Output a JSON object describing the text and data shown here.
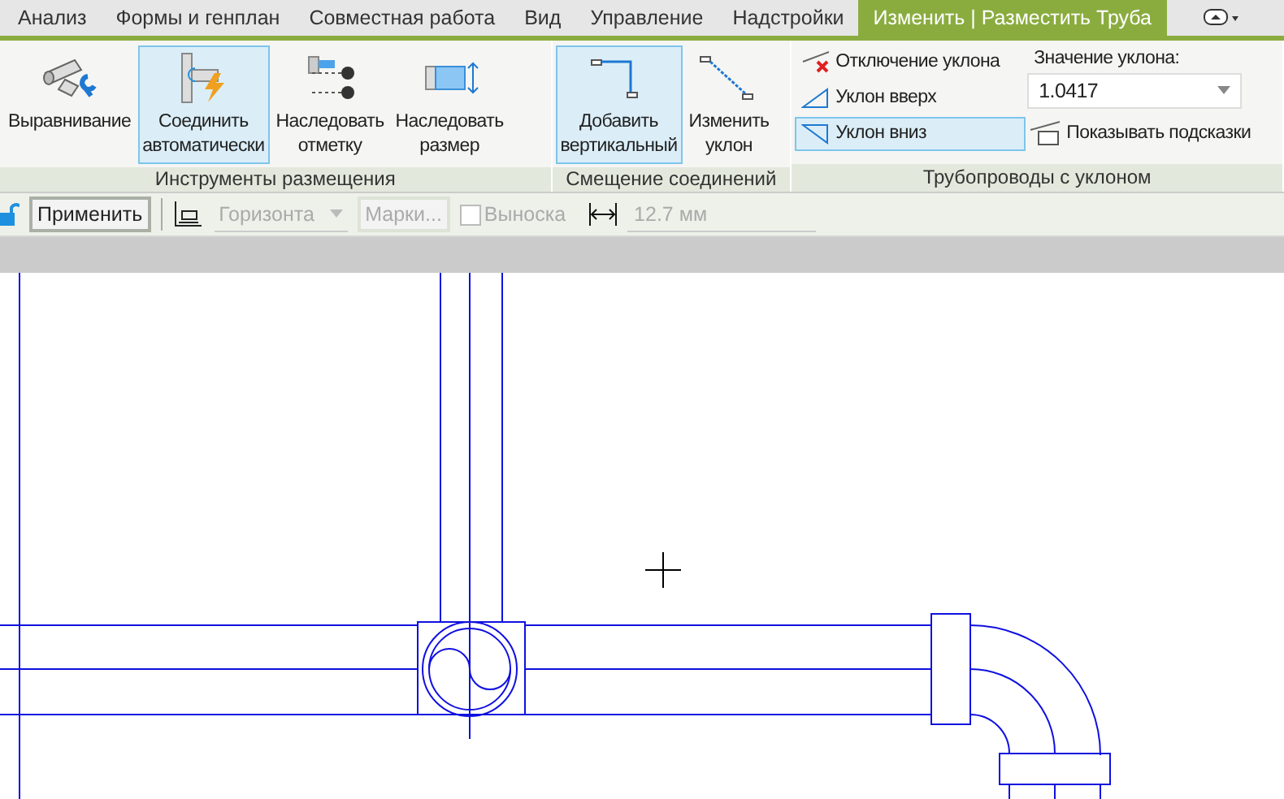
{
  "tabs": [
    {
      "label": "Анализ",
      "selected": false
    },
    {
      "label": "Формы и генплан",
      "selected": false
    },
    {
      "label": "Совместная работа",
      "selected": false
    },
    {
      "label": "Вид",
      "selected": false
    },
    {
      "label": "Управление",
      "selected": false
    },
    {
      "label": "Надстройки",
      "selected": false
    },
    {
      "label": "Изменить | Разместить Труба",
      "selected": true
    }
  ],
  "ribbon": {
    "panels": [
      {
        "title": "Инструменты размещения",
        "tools": [
          {
            "kind": "align",
            "label": "Выравнивание",
            "selected": false
          },
          {
            "kind": "autoconnect",
            "label": "Соединить\nавтоматически",
            "selected": true
          },
          {
            "kind": "inherit_elevation",
            "label": "Наследовать\nотметку",
            "selected": false
          },
          {
            "kind": "inherit_size",
            "label": "Наследовать\nразмер",
            "selected": false
          }
        ]
      },
      {
        "title": "Смещение соединений",
        "tools": [
          {
            "kind": "add_vertical",
            "label": "Добавить\nвертикальный",
            "selected": true
          },
          {
            "kind": "change_slope",
            "label": "Изменить\nуклон",
            "selected": false
          }
        ]
      },
      {
        "title": "Трубопроводы с уклоном",
        "slope_options": [
          {
            "kind": "off",
            "label": "Отключение уклона",
            "selected": false
          },
          {
            "kind": "up",
            "label": "Уклон вверх",
            "selected": false
          },
          {
            "kind": "down",
            "label": "Уклон вниз",
            "selected": true
          }
        ],
        "slope_value": {
          "label": "Значение уклона:",
          "value": "1.0417"
        },
        "tooltip_toggle": "Показывать подсказки"
      }
    ]
  },
  "options_bar": {
    "apply": "Применить",
    "placement": {
      "value": "Горизонта",
      "disabled": true
    },
    "tags": {
      "label": "Марки...",
      "disabled": true
    },
    "leader": {
      "label": "Выноска",
      "checked": false,
      "disabled": true
    },
    "offset": {
      "value": "12.7 мм",
      "disabled": true
    }
  }
}
